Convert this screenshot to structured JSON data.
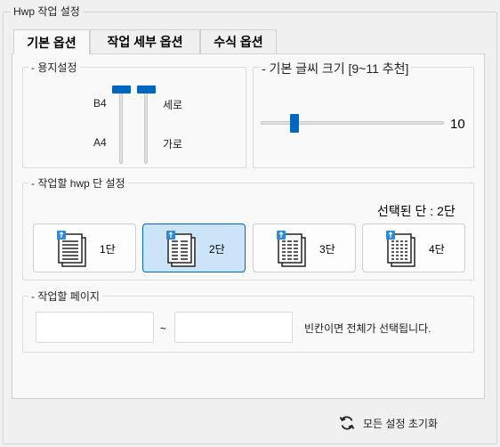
{
  "window": {
    "group_title": "Hwp 작업 설정"
  },
  "tabs": [
    {
      "label": "기본 옵션",
      "active": true
    },
    {
      "label": "작업 세부 옵션",
      "active": false
    },
    {
      "label": "수식 옵션",
      "active": false
    }
  ],
  "paper": {
    "title": "- 용지설정",
    "labels": {
      "b4": "B4",
      "a4": "A4",
      "portrait": "세로",
      "landscape": "가로"
    }
  },
  "font_size": {
    "title": "- 기본 글씨 크기 [9~11 추천]",
    "value": "10",
    "min": 9,
    "max": 11
  },
  "columns": {
    "title": "- 작업할 hwp 단 설정",
    "selected_text": "선택된 단 : 2단",
    "options": [
      {
        "label": "1단",
        "selected": false,
        "icon": "one-column-document-icon"
      },
      {
        "label": "2단",
        "selected": true,
        "icon": "two-column-document-icon"
      },
      {
        "label": "3단",
        "selected": false,
        "icon": "three-column-document-icon"
      },
      {
        "label": "4단",
        "selected": false,
        "icon": "four-column-document-icon"
      }
    ]
  },
  "pages": {
    "title": "- 작업할 페이지",
    "from_value": "",
    "to_value": "",
    "separator": "~",
    "hint": "빈칸이면 전체가 선택됩니다."
  },
  "reset": {
    "label": "모든 설정 초기화",
    "icon": "refresh-icon"
  },
  "colors": {
    "accent": "#0067c0",
    "selected_bg": "#cce4f7"
  }
}
